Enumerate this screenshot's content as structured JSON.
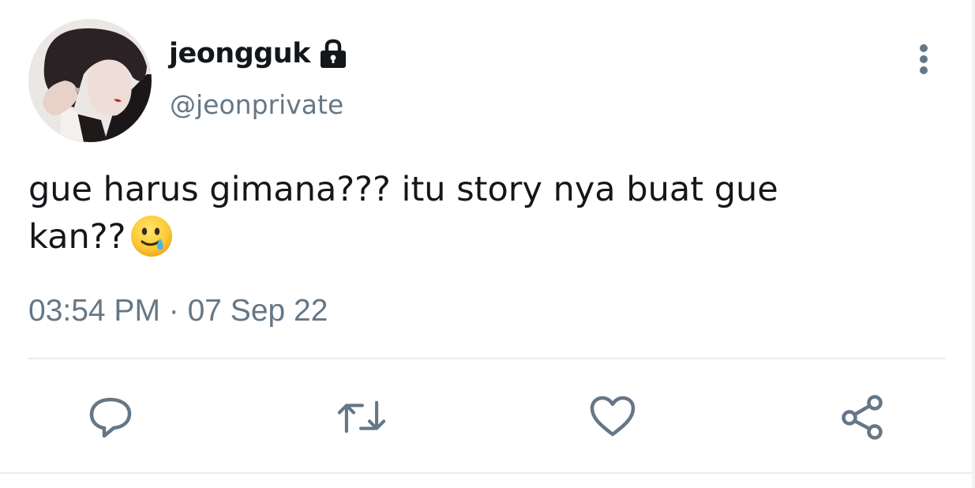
{
  "tweet": {
    "display_name": "jeongguk",
    "handle": "@jeonprivate",
    "text_line1": "gue harus gimana??? itu story nya buat gue",
    "text_line2": "kan??",
    "timestamp": "03:54 PM · 07 Sep 22",
    "protected": true
  },
  "icons": {
    "lock": "lock-icon",
    "more": "more-vertical-icon",
    "emoji": "smiling-face-with-tear-emoji",
    "reply": "reply-icon",
    "retweet": "retweet-icon",
    "like": "heart-icon",
    "share": "share-icon"
  },
  "colors": {
    "text": "#14171a",
    "secondary": "#657786",
    "divider": "#e6ecf0"
  }
}
